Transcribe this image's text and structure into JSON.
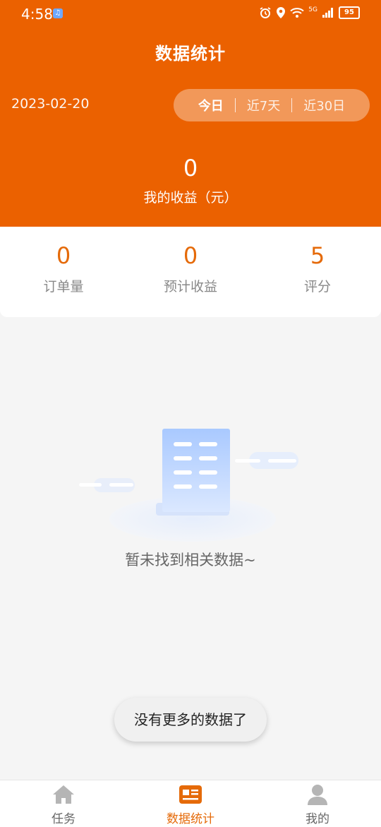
{
  "status_bar": {
    "time": "4:58",
    "network": "5G",
    "battery": "95"
  },
  "header": {
    "title": "数据统计",
    "date": "2023-02-20",
    "ranges": [
      "今日",
      "近7天",
      "近30日"
    ],
    "active_range": "今日",
    "income_value": "0",
    "income_label": "我的收益（元）",
    "accent_color": "#eb6100"
  },
  "stats": [
    {
      "value": "0",
      "label": "订单量"
    },
    {
      "value": "0",
      "label": "预计收益"
    },
    {
      "value": "5",
      "label": "评分"
    }
  ],
  "empty_state": {
    "text": "暂未找到相关数据~"
  },
  "toast": {
    "text": "没有更多的数据了"
  },
  "tabbar": {
    "items": [
      {
        "label": "任务",
        "icon": "home-icon"
      },
      {
        "label": "数据统计",
        "icon": "stats-icon"
      },
      {
        "label": "我的",
        "icon": "user-icon"
      }
    ],
    "active": "数据统计"
  }
}
